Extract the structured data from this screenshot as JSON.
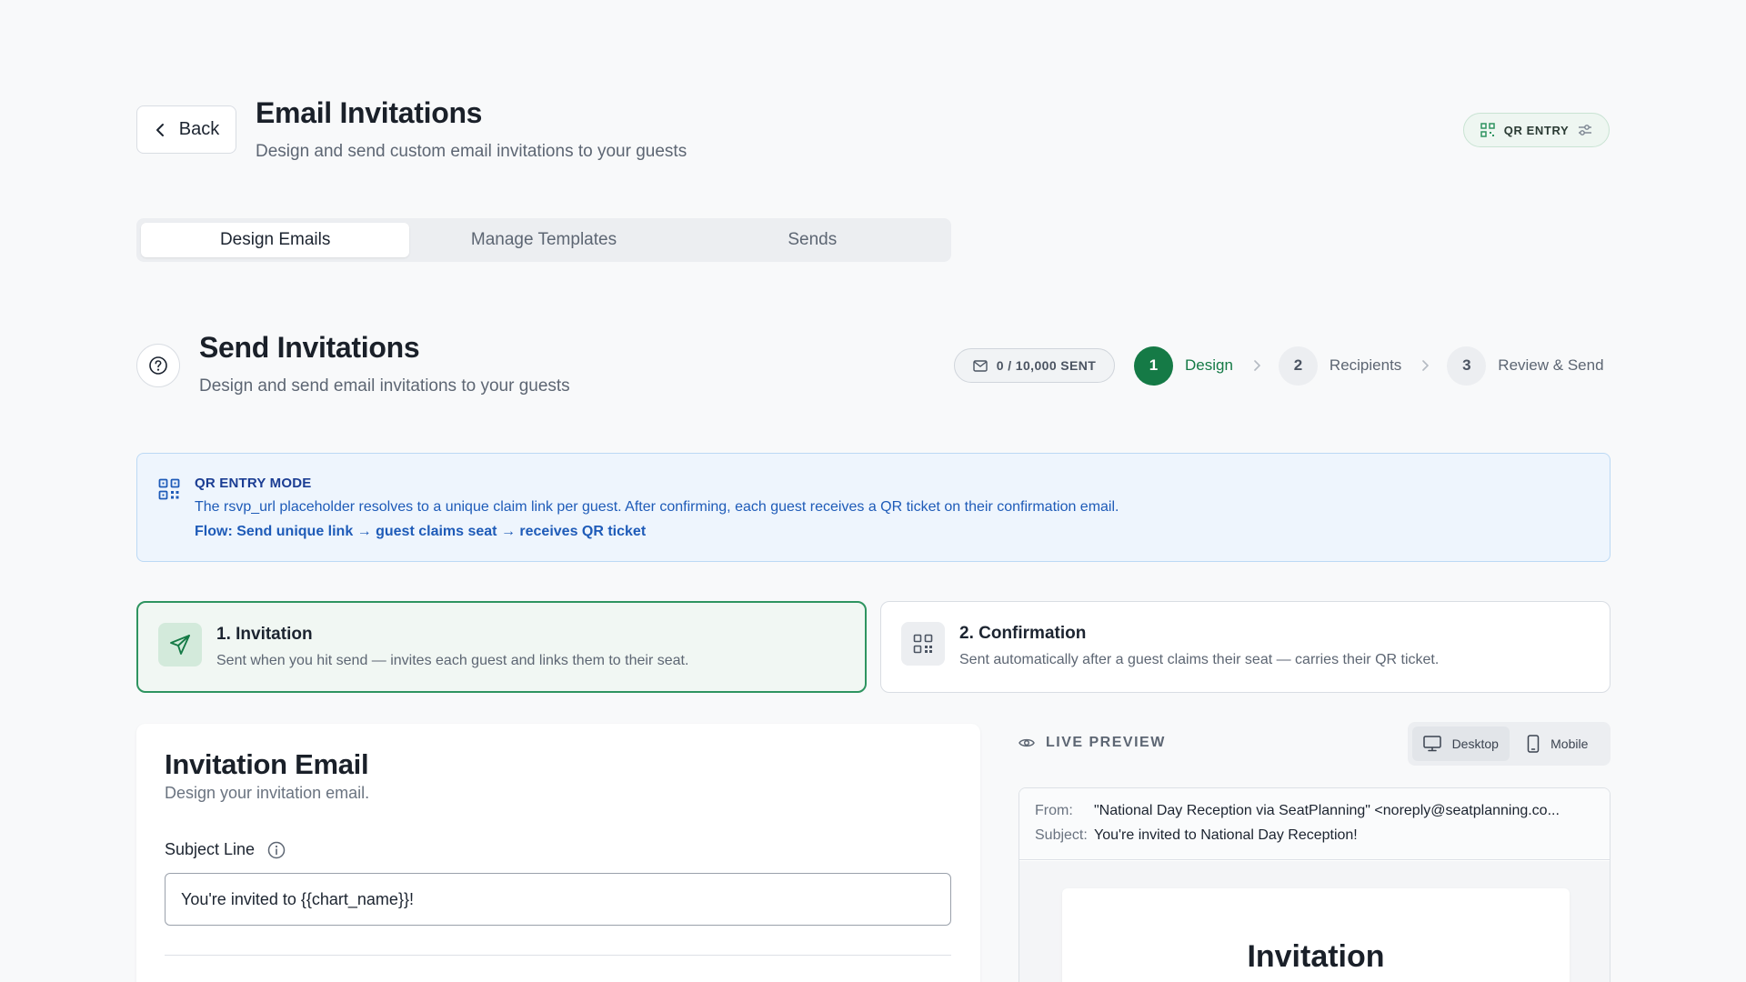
{
  "header": {
    "back_label": "Back",
    "title": "Email Invitations",
    "subtitle": "Design and send custom email invitations to your guests",
    "qr_badge": "QR ENTRY"
  },
  "tabs": [
    {
      "label": "Design Emails",
      "active": true
    },
    {
      "label": "Manage Templates",
      "active": false
    },
    {
      "label": "Sends",
      "active": false
    }
  ],
  "section": {
    "title": "Send Invitations",
    "subtitle": "Design and send email invitations to your guests",
    "sent_count": "0 / 10,000 SENT"
  },
  "steps": [
    {
      "number": "1",
      "label": "Design",
      "active": true
    },
    {
      "number": "2",
      "label": "Recipients",
      "active": false
    },
    {
      "number": "3",
      "label": "Review & Send",
      "active": false
    }
  ],
  "qr_mode": {
    "title": "QR ENTRY MODE",
    "line1": "The rsvp_url placeholder resolves to a unique claim link per guest. After confirming, each guest receives a QR ticket on their confirmation email.",
    "line2": "Flow: Send unique link → guest claims seat → receives QR ticket"
  },
  "email_types": [
    {
      "title": "1. Invitation",
      "description": "Sent when you hit send — invites each guest and links them to their seat.",
      "icon": "send-icon",
      "active": true
    },
    {
      "title": "2. Confirmation",
      "description": "Sent automatically after a guest claims their seat — carries their QR ticket.",
      "icon": "qr-code-icon",
      "active": false
    }
  ],
  "editor": {
    "title": "Invitation Email",
    "subtitle": "Design your invitation email.",
    "subject_label": "Subject Line",
    "subject_value": "You're invited to {{chart_name}}!"
  },
  "preview": {
    "label": "LIVE PREVIEW",
    "devices": [
      {
        "label": "Desktop",
        "active": true
      },
      {
        "label": "Mobile",
        "active": false
      }
    ],
    "from_key": "From:",
    "from_value": "\"National Day Reception via SeatPlanning\" <noreply@seatplanning.co...",
    "subject_key": "Subject:",
    "subject_value": "You're invited to National Day Reception!",
    "heading": "Invitation"
  },
  "colors": {
    "accent_green": "#157a46",
    "info_blue": "#1e5bb8",
    "info_bg": "#eef5fd"
  }
}
